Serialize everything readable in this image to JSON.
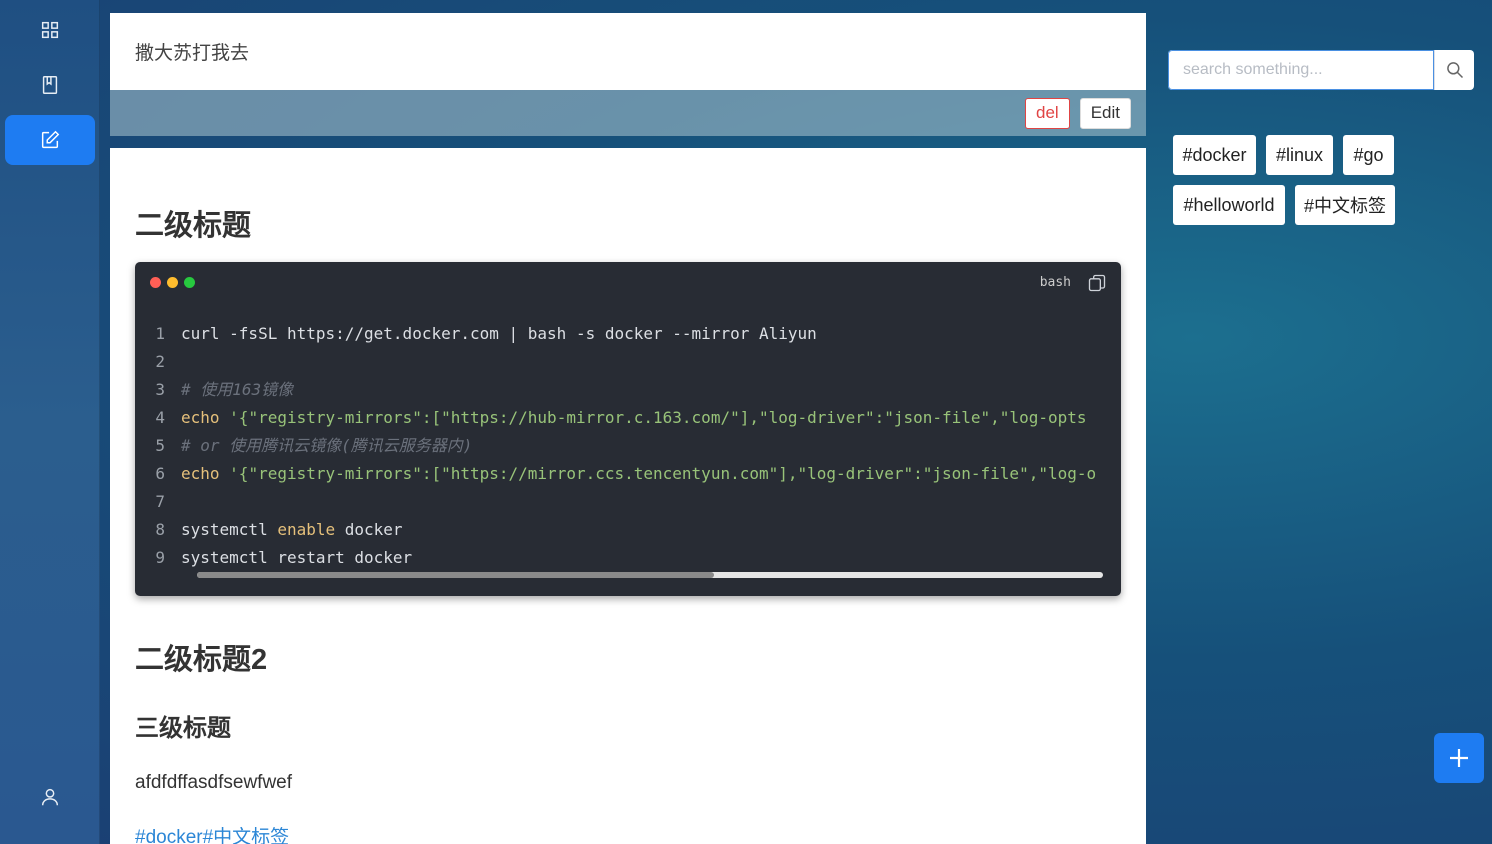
{
  "nav": {
    "items": [
      {
        "icon": "grid-icon",
        "active": false
      },
      {
        "icon": "book-icon",
        "active": false
      },
      {
        "icon": "edit-icon",
        "active": true
      }
    ],
    "bottom_icon": "user-icon"
  },
  "article": {
    "title": "撒大苏打我去",
    "actions": {
      "delete_label": "del",
      "edit_label": "Edit"
    },
    "h2_first": "二级标题",
    "code": {
      "lang": "bash",
      "lines": [
        {
          "num": "1",
          "segments": [
            {
              "t": "curl -fsSL https://get.docker.com | bash -s docker --mirror Aliyun",
              "c": "src"
            }
          ]
        },
        {
          "num": "2",
          "segments": []
        },
        {
          "num": "3",
          "segments": [
            {
              "t": "# 使用163镜像",
              "c": "c-cm"
            }
          ]
        },
        {
          "num": "4",
          "segments": [
            {
              "t": "echo",
              "c": "c-kw"
            },
            {
              "t": " ",
              "c": "src"
            },
            {
              "t": "'{\"registry-mirrors\":[\"https://hub-mirror.c.163.com/\"],\"log-driver\":\"json-file\",\"log-opts",
              "c": "c-str"
            }
          ]
        },
        {
          "num": "5",
          "segments": [
            {
              "t": "# or 使用腾讯云镜像(腾讯云服务器内)",
              "c": "c-cm"
            }
          ]
        },
        {
          "num": "6",
          "segments": [
            {
              "t": "echo",
              "c": "c-kw"
            },
            {
              "t": " ",
              "c": "src"
            },
            {
              "t": "'{\"registry-mirrors\":[\"https://mirror.ccs.tencentyun.com\"],\"log-driver\":\"json-file\",\"log-o",
              "c": "c-str"
            }
          ]
        },
        {
          "num": "7",
          "segments": []
        },
        {
          "num": "8",
          "segments": [
            {
              "t": "systemctl ",
              "c": "src"
            },
            {
              "t": "enable",
              "c": "c-kw"
            },
            {
              "t": " docker",
              "c": "src"
            }
          ]
        },
        {
          "num": "9",
          "segments": [
            {
              "t": "systemctl restart docker",
              "c": "src"
            }
          ]
        }
      ]
    },
    "h2_second": "二级标题2",
    "h3": "三级标题",
    "paragraph": "afdfdffasdfsewfwef",
    "tag_links": "#docker#中文标签"
  },
  "search": {
    "placeholder": "search something..."
  },
  "tags": [
    "#docker",
    "#linux",
    "#go",
    "#helloworld",
    "#中文标签"
  ],
  "colors": {
    "accent": "#1e7cf2",
    "danger": "#e04444",
    "code_bg": "#282c34"
  }
}
